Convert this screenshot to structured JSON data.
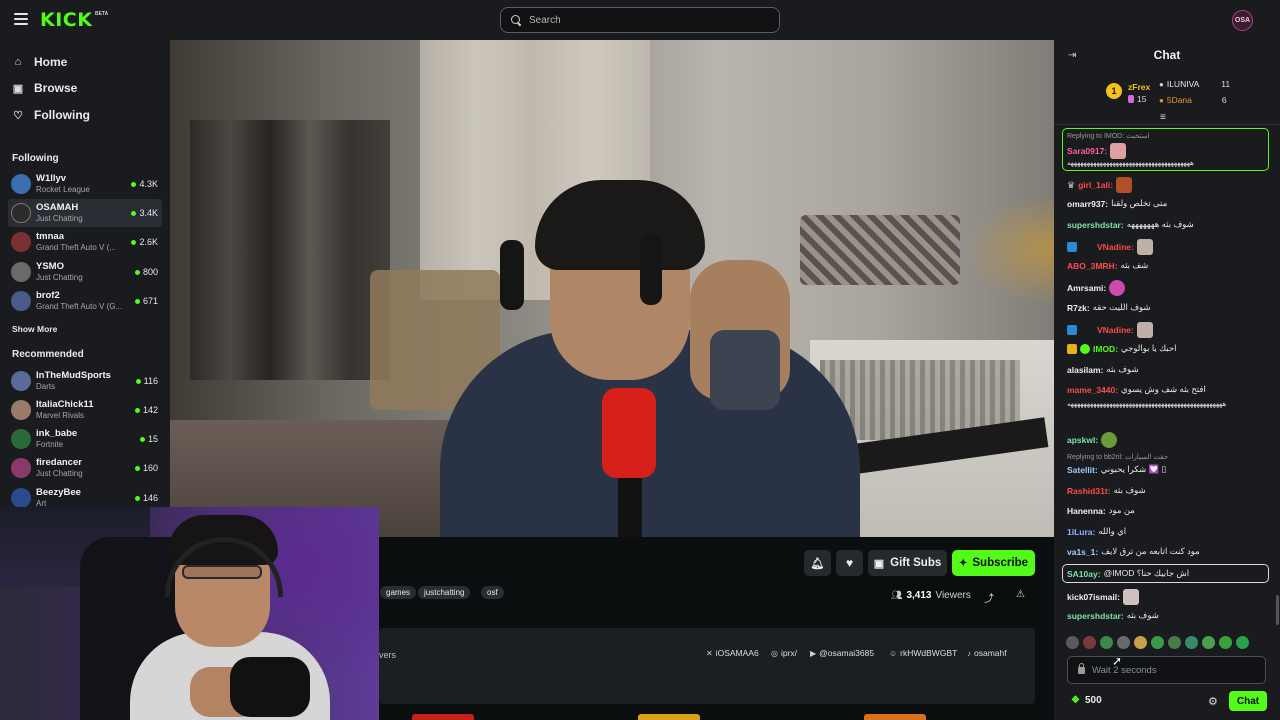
{
  "header": {
    "logo": "KICK",
    "logo_badge": "BETA",
    "search_placeholder": "Search",
    "avatar_text": "OSA"
  },
  "nav": [
    {
      "label": "Home",
      "icon": "home-icon"
    },
    {
      "label": "Browse",
      "icon": "compass-icon"
    },
    {
      "label": "Following",
      "icon": "heart-icon"
    }
  ],
  "following": {
    "title": "Following",
    "channels": [
      {
        "name": "W1llyv",
        "category": "Rocket League",
        "viewers": "4.3K",
        "color": "#3a6fb0"
      },
      {
        "name": "OSAMAH",
        "category": "Just Chatting",
        "viewers": "3.4K",
        "color": "#2b2b2b"
      },
      {
        "name": "tmnaa",
        "category": "Grand Theft Auto V (...",
        "viewers": "2.6K",
        "color": "#7a3030"
      },
      {
        "name": "YSMO",
        "category": "Just Chatting",
        "viewers": "800",
        "color": "#6a6a6a"
      },
      {
        "name": "brof2",
        "category": "Grand Theft Auto V (G...",
        "viewers": "671",
        "color": "#4a5a8a"
      }
    ],
    "show_more": "Show More"
  },
  "recommended": {
    "title": "Recommended",
    "channels": [
      {
        "name": "InTheMudSports",
        "category": "Darts",
        "viewers": "116",
        "color": "#5a6a9a"
      },
      {
        "name": "ItaliaChick11",
        "category": "Marvel Rivals",
        "viewers": "142",
        "color": "#9a7a6a"
      },
      {
        "name": "ink_babe",
        "category": "Fortnite",
        "viewers": "15",
        "color": "#2a6a3a"
      },
      {
        "name": "firedancer",
        "category": "Just Chatting",
        "viewers": "160",
        "color": "#8a3a6a"
      },
      {
        "name": "BeezyBee",
        "category": "Art",
        "viewers": "146",
        "color": "#2a4a8a"
      }
    ]
  },
  "stream": {
    "gift_subs": "Gift Subs",
    "subscribe": "Subscribe",
    "viewers_count": "3,413",
    "viewers_label": "Viewers",
    "tags": [
      "games",
      "justchatting",
      "osf"
    ],
    "partial_label": "vers",
    "socials": [
      {
        "icon": "x-icon",
        "label": "iOSAMAA6"
      },
      {
        "icon": "instagram-icon",
        "label": "iprx/"
      },
      {
        "icon": "youtube-icon",
        "label": "@osamai3685"
      },
      {
        "icon": "discord-icon",
        "label": "rkHWdBWGBT"
      },
      {
        "icon": "tiktok-icon",
        "label": "osamahf"
      }
    ]
  },
  "chat": {
    "title": "Chat",
    "leaderboard": {
      "first": {
        "rank": "1",
        "name": "zFrex",
        "count": "15"
      },
      "second": {
        "name": "ILUNIVA",
        "count": "11"
      },
      "third": {
        "name": "5Dana",
        "count": "6"
      }
    },
    "messages": [
      {
        "reply": "Replying to IMOD: استخبث"
      },
      {
        "user": "Sara0917:",
        "text": "",
        "color": "#ff5fa2"
      },
      {
        "user": "",
        "text": "ههههههههههههههههههههههههههههههههههههههه",
        "color": "#e8e8e8"
      },
      {
        "user": "girl_1ali:",
        "text": "",
        "color": "#ff4a4a"
      },
      {
        "user": "omarr937:",
        "text": "متى تخلص ولقنا",
        "color": "#f0f0f0"
      },
      {
        "user": "supershdstar:",
        "text": "شوف بثه هههههههه",
        "color": "#7fe3a6"
      },
      {
        "user": "VNadine:",
        "text": "",
        "color": "#ff4a4a"
      },
      {
        "user": "ABO_3MRH:",
        "text": "شف بثه",
        "color": "#ff4a4a"
      },
      {
        "user": "Amrsami:",
        "text": "",
        "color": "#f0f0f0"
      },
      {
        "user": "R7zk:",
        "text": "شوف الليت حقه",
        "color": "#f0f0f0"
      },
      {
        "user": "VNadine:",
        "text": "",
        "color": "#ff4a4a"
      },
      {
        "user": "IMOD:",
        "text": "احبك يا بوالوجي",
        "color": "#53fc18"
      },
      {
        "user": "alasilam:",
        "text": "شوف بثه",
        "color": "#f0f0f0"
      },
      {
        "user": "mame_3440:",
        "text": "افتح بثه شف وش يسوي",
        "color": "#ff4a4a"
      },
      {
        "user": "",
        "text": "ههههههههههههههههههههههههههههههههههههههههههههههههه",
        "color": "#e8e8e8"
      },
      {
        "user": "apskwl:",
        "text": "",
        "color": "#7fe3a6"
      },
      {
        "reply": "Replying to bb2ril: حقت السيارات"
      },
      {
        "user": "Satellit:",
        "text": "شكرا يحبوني 💟 ▯",
        "color": "#9ad0ff"
      },
      {
        "user": "Rashid31t:",
        "text": "شوف بثه",
        "color": "#ff4a4a"
      },
      {
        "user": "Hanenna:",
        "text": "من مود",
        "color": "#f0f0f0"
      },
      {
        "user": "1iLura:",
        "text": "اي والله",
        "color": "#8ab4ff"
      },
      {
        "user": "va1s_1:",
        "text": "مود كنت اتابعه من ترق لايف",
        "color": "#9ad0ff"
      },
      {
        "user": "SA10ay:",
        "text": "@IMOD اش جابيك حنا؟",
        "color": "#7fe3a6"
      },
      {
        "user": "kick07ismail:",
        "text": "",
        "color": "#f0f0f0"
      },
      {
        "user": "supershdstar:",
        "text": "شوف بثه",
        "color": "#7fe3a6"
      }
    ],
    "input_placeholder": "Wait 2 seconds",
    "points": "500",
    "send": "Chat"
  },
  "colors": {
    "accent": "#53fc18",
    "bg": "#0b0e0f",
    "panel": "#191b1f"
  }
}
